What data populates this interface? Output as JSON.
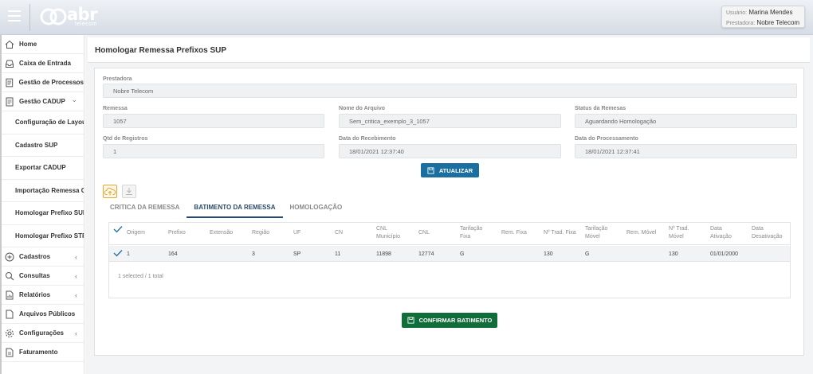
{
  "header": {
    "logo_text": "abr",
    "logo_sub": "telecom",
    "user_label": "Usuário:",
    "user_value": "Marina Mendes",
    "company_label": "Prestadora:",
    "company_value": "Nobre Telecom"
  },
  "sidebar": {
    "items": [
      {
        "label": "Home",
        "icon": "home-icon"
      },
      {
        "label": "Caixa de Entrada",
        "icon": "inbox-icon"
      },
      {
        "label": "Gestão de Processos",
        "icon": "document-icon",
        "chevron": "‹"
      },
      {
        "label": "Gestão CADUP",
        "icon": "document-icon",
        "chevron": "⌄"
      }
    ],
    "subitems": [
      {
        "label": "Configuração de Layout"
      },
      {
        "label": "Cadastro SUP"
      },
      {
        "label": "Exportar CADUP"
      },
      {
        "label": "Importação Remessa CADUP"
      },
      {
        "label": "Homologar Prefixo SUP"
      },
      {
        "label": "Homologar Prefixo STFC..."
      }
    ],
    "bottom_items": [
      {
        "label": "Cadastros",
        "icon": "plus-circle-icon",
        "chevron": "‹"
      },
      {
        "label": "Consultas",
        "icon": "search-icon",
        "chevron": "‹"
      },
      {
        "label": "Relatórios",
        "icon": "report-icon",
        "chevron": "‹"
      },
      {
        "label": "Arquivos Públicos",
        "icon": "file-icon"
      },
      {
        "label": "Configurações",
        "icon": "gear-icon",
        "chevron": "‹"
      },
      {
        "label": "Faturamento",
        "icon": "file-icon"
      }
    ]
  },
  "page": {
    "title": "Homologar Remessa Prefixos SUP"
  },
  "form": {
    "prestadora_label": "Prestadora",
    "prestadora_value": "Nobre Telecom",
    "remessa_label": "Remessa",
    "remessa_value": "1057",
    "arquivo_label": "Nome do Arquivo",
    "arquivo_value": "Sem_critica_exemplo_3_1057",
    "status_label": "Status da Remesas",
    "status_value": "Aguardando Homologação",
    "qtd_label": "Qtd de Registros",
    "qtd_value": "1",
    "recebimento_label": "Data do Recebimento",
    "recebimento_value": "18/01/2021 12:37:40",
    "processamento_label": "Data do Processamento",
    "processamento_value": "18/01/2021 12:37:41",
    "atualizar_label": "ATUALIZAR"
  },
  "tabs": [
    {
      "label": "CRITICA DA REMESSA"
    },
    {
      "label": "BATIMENTO DA REMESSA"
    },
    {
      "label": "HOMOLOGAÇÃO"
    }
  ],
  "table": {
    "headers": [
      "Origem",
      "Prefixo",
      "Extensão",
      "Região",
      "UF",
      "CN",
      "CNL Município",
      "CNL",
      "Tarifação Fixa",
      "Rem. Fixa",
      "Nº Trad. Fixa",
      "Tarifação Móvel",
      "Rem. Móvel",
      "Nº Trad. Móvel",
      "Data Ativação",
      "Data Desativação"
    ],
    "rows": [
      [
        "1",
        "164",
        "",
        "3",
        "SP",
        "11",
        "11898",
        "12774",
        "G",
        "",
        "130",
        "G",
        "",
        "130",
        "01/01/2000",
        ""
      ]
    ],
    "footer": "1 selected / 1 total"
  },
  "confirm_label": "CONFIRMAR BATIMENTO",
  "colors": {
    "primary": "#1a6fa0",
    "success": "#116d3a",
    "active_tab": "#2a4a6b",
    "check": "#1a6fa0"
  }
}
